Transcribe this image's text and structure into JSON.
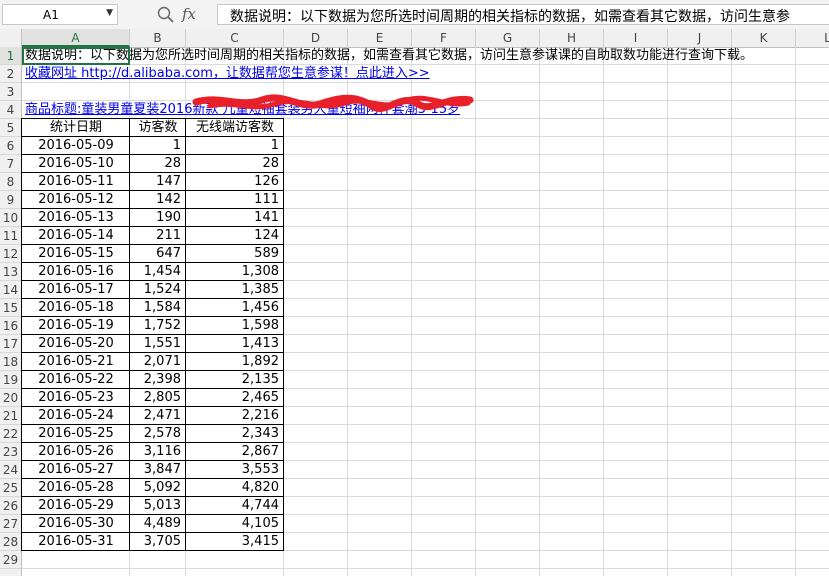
{
  "formula_bar": {
    "name_box": "A1",
    "formula": "数据说明：以下数据为您所选时间周期的相关指标的数据，如需查看其它数据，访问生意参"
  },
  "columns": [
    "A",
    "B",
    "C",
    "D",
    "E",
    "F",
    "G",
    "H",
    "I",
    "J",
    "K",
    "L"
  ],
  "rows": [
    "1",
    "2",
    "3",
    "4",
    "5",
    "6",
    "7",
    "8",
    "9",
    "10",
    "11",
    "12",
    "13",
    "14",
    "15",
    "16",
    "17",
    "18",
    "19",
    "20",
    "21",
    "22",
    "23",
    "24",
    "25",
    "26",
    "27",
    "28",
    "29"
  ],
  "sheet": {
    "note": "数据说明：以下数据为您所选时间周期的相关指标的数据，如需查看其它数据，访问生意参谋课的自助取数功能进行查询下载。",
    "favorite_link": "收藏网址 http://d.alibaba.com，让数据帮您生意参谋！点此进入>>",
    "product_title": "商品标题:童装男童夏装2016新款  儿童短袖套装男大童短袖两件套潮3-15岁",
    "table": {
      "headers": [
        "统计日期",
        "访客数",
        "无线端访客数"
      ],
      "rows": [
        [
          "2016-05-09",
          "1",
          "1"
        ],
        [
          "2016-05-10",
          "28",
          "28"
        ],
        [
          "2016-05-11",
          "147",
          "126"
        ],
        [
          "2016-05-12",
          "142",
          "111"
        ],
        [
          "2016-05-13",
          "190",
          "141"
        ],
        [
          "2016-05-14",
          "211",
          "124"
        ],
        [
          "2016-05-15",
          "647",
          "589"
        ],
        [
          "2016-05-16",
          "1,454",
          "1,308"
        ],
        [
          "2016-05-17",
          "1,524",
          "1,385"
        ],
        [
          "2016-05-18",
          "1,584",
          "1,456"
        ],
        [
          "2016-05-19",
          "1,752",
          "1,598"
        ],
        [
          "2016-05-20",
          "1,551",
          "1,413"
        ],
        [
          "2016-05-21",
          "2,071",
          "1,892"
        ],
        [
          "2016-05-22",
          "2,398",
          "2,135"
        ],
        [
          "2016-05-23",
          "2,805",
          "2,465"
        ],
        [
          "2016-05-24",
          "2,471",
          "2,216"
        ],
        [
          "2016-05-25",
          "2,578",
          "2,343"
        ],
        [
          "2016-05-26",
          "3,116",
          "2,867"
        ],
        [
          "2016-05-27",
          "3,847",
          "3,553"
        ],
        [
          "2016-05-28",
          "5,092",
          "4,820"
        ],
        [
          "2016-05-29",
          "5,013",
          "4,744"
        ],
        [
          "2016-05-30",
          "4,489",
          "4,105"
        ],
        [
          "2016-05-31",
          "3,705",
          "3,415"
        ]
      ]
    }
  },
  "colors": {
    "selection": "#217346",
    "link": "#0000ee",
    "redaction": "#e8202a"
  }
}
